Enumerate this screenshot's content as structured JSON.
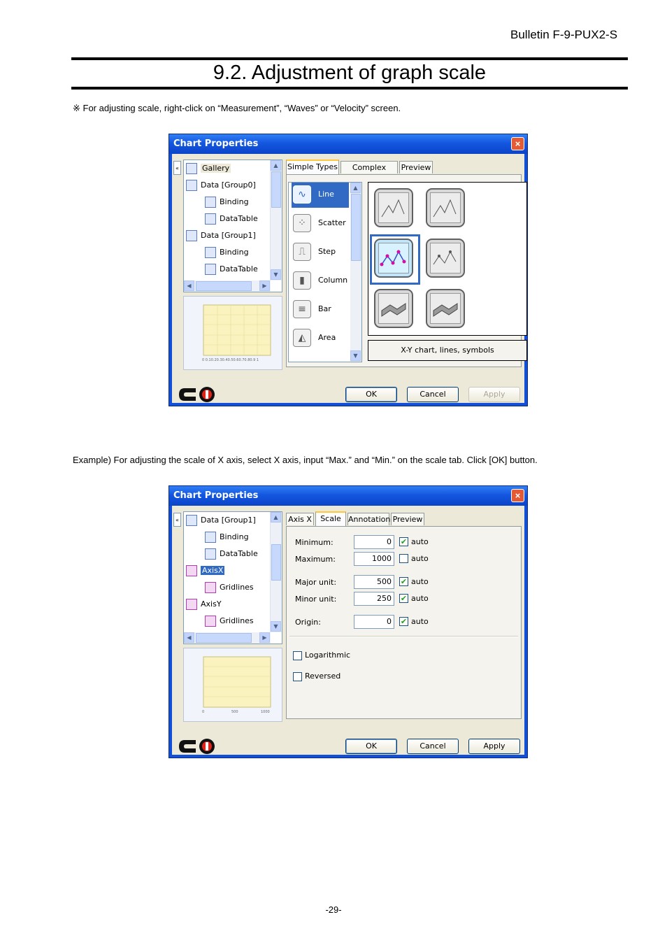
{
  "header": {
    "bulletin": "Bulletin F-9-PUX2-S"
  },
  "section_title": "9.2. Adjustment of graph scale",
  "note": "※ For adjusting scale, right-click on “Measurement”, “Waves” or “Velocity” screen.",
  "example": "Example) For adjusting the scale of X axis, select X axis, input “Max.” and “Min.” on the scale tab. Click [OK] button.",
  "page_number": "-29-",
  "dialog1": {
    "title": "Chart Properties",
    "close": "×",
    "collapse": "«",
    "tree": [
      "Gallery",
      "Data [Group0]",
      "Binding",
      "DataTable",
      "Data [Group1]",
      "Binding",
      "DataTable"
    ],
    "tabs": [
      "Simple Types",
      "Complex Types",
      "Preview"
    ],
    "types": [
      "Line",
      "Scatter",
      "Step",
      "Column",
      "Bar",
      "Area"
    ],
    "description": "X-Y chart, lines, symbols",
    "preview_xticks": "0 0.10.20.30.40.50.60.70.80.9 1",
    "buttons": {
      "ok": "OK",
      "cancel": "Cancel",
      "apply": "Apply"
    }
  },
  "dialog2": {
    "title": "Chart Properties",
    "close": "×",
    "collapse": "«",
    "tree": [
      "Data [Group1]",
      "Binding",
      "DataTable",
      "AxisX",
      "Gridlines",
      "AxisY",
      "Gridlines"
    ],
    "tabs": [
      "Axis X",
      "Scale",
      "Annotation",
      "Preview"
    ],
    "fields": [
      {
        "label": "Minimum:",
        "value": "0",
        "auto_label": "auto",
        "auto": true
      },
      {
        "label": "Maximum:",
        "value": "1000",
        "auto_label": "auto",
        "auto": false
      },
      {
        "label": "Major unit:",
        "value": "500",
        "auto_label": "auto",
        "auto": true
      },
      {
        "label": "Minor unit:",
        "value": "250",
        "auto_label": "auto",
        "auto": true
      },
      {
        "label": "Origin:",
        "value": "0",
        "auto_label": "auto",
        "auto": true
      }
    ],
    "options": [
      {
        "label": "Logarithmic",
        "checked": false
      },
      {
        "label": "Reversed",
        "checked": false
      }
    ],
    "preview_xticks": [
      "0",
      "500",
      "1000"
    ],
    "buttons": {
      "ok": "OK",
      "cancel": "Cancel",
      "apply": "Apply"
    }
  }
}
